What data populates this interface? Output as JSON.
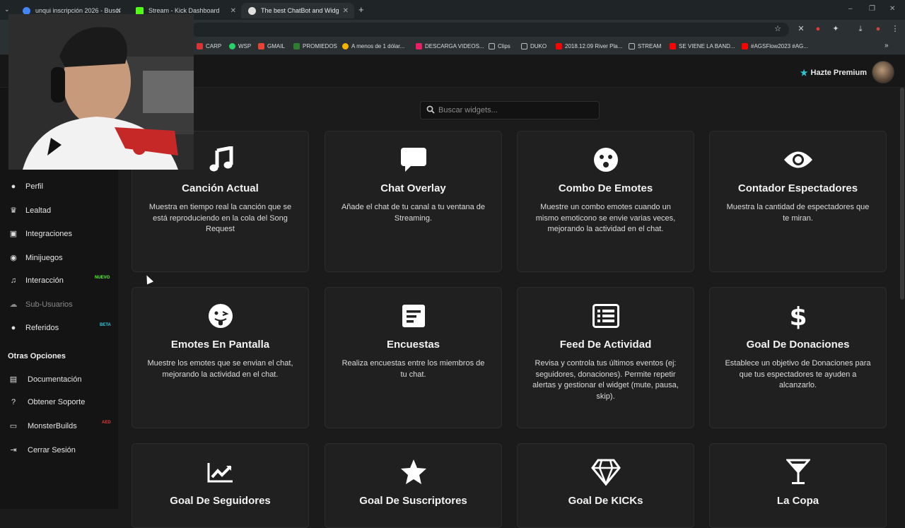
{
  "browser": {
    "tabs": [
      {
        "title": "unqui inscripción 2026 - Buscar",
        "favicon_color": "#4285f4",
        "active": false
      },
      {
        "title": "Stream - Kick Dashboard",
        "favicon_color": "#53fc18",
        "active": false
      },
      {
        "title": "The best ChatBot and Widgets",
        "favicon_color": "#e0e0e0",
        "active": true
      }
    ],
    "new_tab": "+",
    "bookmarks": [
      {
        "label": "CARP",
        "color": "#d33"
      },
      {
        "label": "WSP",
        "color": "#25d366"
      },
      {
        "label": "GMAIL",
        "color": "#ea4335"
      },
      {
        "label": "PROMIEDOS",
        "color": "#2e7d32"
      },
      {
        "label": "A menos de 1 dólar...",
        "color": "#f4b400"
      },
      {
        "label": "DESCARGA VIDEOS...",
        "color": "#e91e63"
      },
      {
        "label": "Clips",
        "color": "#9e9e9e"
      },
      {
        "label": "DUKO",
        "color": "#9e9e9e"
      },
      {
        "label": "2018.12.09 River Pla...",
        "color": "#ff0000"
      },
      {
        "label": "STREAM",
        "color": "#9e9e9e"
      },
      {
        "label": "SE VIENE LA BAND...",
        "color": "#ff0000"
      },
      {
        "label": "#AGSFlow2023 #AG...",
        "color": "#ff0000"
      }
    ]
  },
  "header": {
    "premium_label": "Hazte Premium"
  },
  "sidebar": {
    "items": [
      {
        "label": "Perfil",
        "icon": "user-icon",
        "glyph": "👤",
        "dim": false
      },
      {
        "label": "Lealtad",
        "icon": "trophy-icon",
        "glyph": "🏆",
        "dim": false
      },
      {
        "label": "Integraciones",
        "icon": "integrations-icon",
        "glyph": "▣",
        "dim": false
      },
      {
        "label": "Minijuegos",
        "icon": "gamepad-icon",
        "glyph": "🎮",
        "dim": false
      },
      {
        "label": "Interacción",
        "icon": "music-icon",
        "glyph": "♫",
        "dim": false,
        "badge": "NUEVO",
        "badge_color": "#53fc18"
      },
      {
        "label": "Sub-Usuarios",
        "icon": "cloud-icon",
        "glyph": "☁",
        "dim": true
      },
      {
        "label": "Referidos",
        "icon": "users-icon",
        "glyph": "👥",
        "dim": false,
        "badge": "BETA",
        "badge_color": "#2ec7d6"
      }
    ],
    "section_title": "Otras Opciones",
    "other_items": [
      {
        "label": "Documentación",
        "icon": "docs-icon",
        "glyph": "▤"
      },
      {
        "label": "Obtener Soporte",
        "icon": "help-icon",
        "glyph": "?"
      },
      {
        "label": "MonsterBuilds",
        "icon": "laptop-icon",
        "glyph": "▭",
        "badge": "AED",
        "badge_color": "#e53935"
      },
      {
        "label": "Cerrar Sesión",
        "icon": "logout-icon",
        "glyph": "⇥"
      }
    ]
  },
  "search": {
    "placeholder": "Buscar widgets..."
  },
  "widgets": [
    {
      "title": "Canción Actual",
      "icon": "music-note-icon",
      "desc": "Muestra en tiempo real la canción que se está reproduciendo en la cola del Song Request"
    },
    {
      "title": "Chat Overlay",
      "icon": "chat-bubble-icon",
      "desc": "Añade el chat de tu canal a tu ventana de Streaming."
    },
    {
      "title": "Combo De Emotes",
      "icon": "surprised-face-icon",
      "desc": "Muestre un combo emotes cuando un mismo emoticono se envie varias veces, mejorando la actividad en el chat."
    },
    {
      "title": "Contador Espectadores",
      "icon": "eye-icon",
      "desc": "Muestra la cantidad de espectadores que te miran."
    },
    {
      "title": "Emotes En Pantalla",
      "icon": "tongue-face-icon",
      "desc": "Muestre los emotes que se envian el chat, mejorando la actividad en el chat."
    },
    {
      "title": "Encuestas",
      "icon": "poll-icon",
      "desc": "Realiza encuestas entre los miembros de tu chat."
    },
    {
      "title": "Feed De Actividad",
      "icon": "list-icon",
      "desc": "Revisa y controla tus últimos eventos (ej: seguidores, donaciones). Permite repetir alertas y gestionar el widget (mute, pausa, skip)."
    },
    {
      "title": "Goal De Donaciones",
      "icon": "dollar-icon",
      "desc": "Establece un objetivo de Donaciones para que tus espectadores te ayuden a alcanzarlo."
    },
    {
      "title": "Goal De Seguidores",
      "icon": "chart-line-icon",
      "desc": ""
    },
    {
      "title": "Goal De Suscriptores",
      "icon": "star-icon",
      "desc": ""
    },
    {
      "title": "Goal De KICKs",
      "icon": "diamond-icon",
      "desc": ""
    },
    {
      "title": "La Copa",
      "icon": "cocktail-icon",
      "desc": ""
    }
  ]
}
